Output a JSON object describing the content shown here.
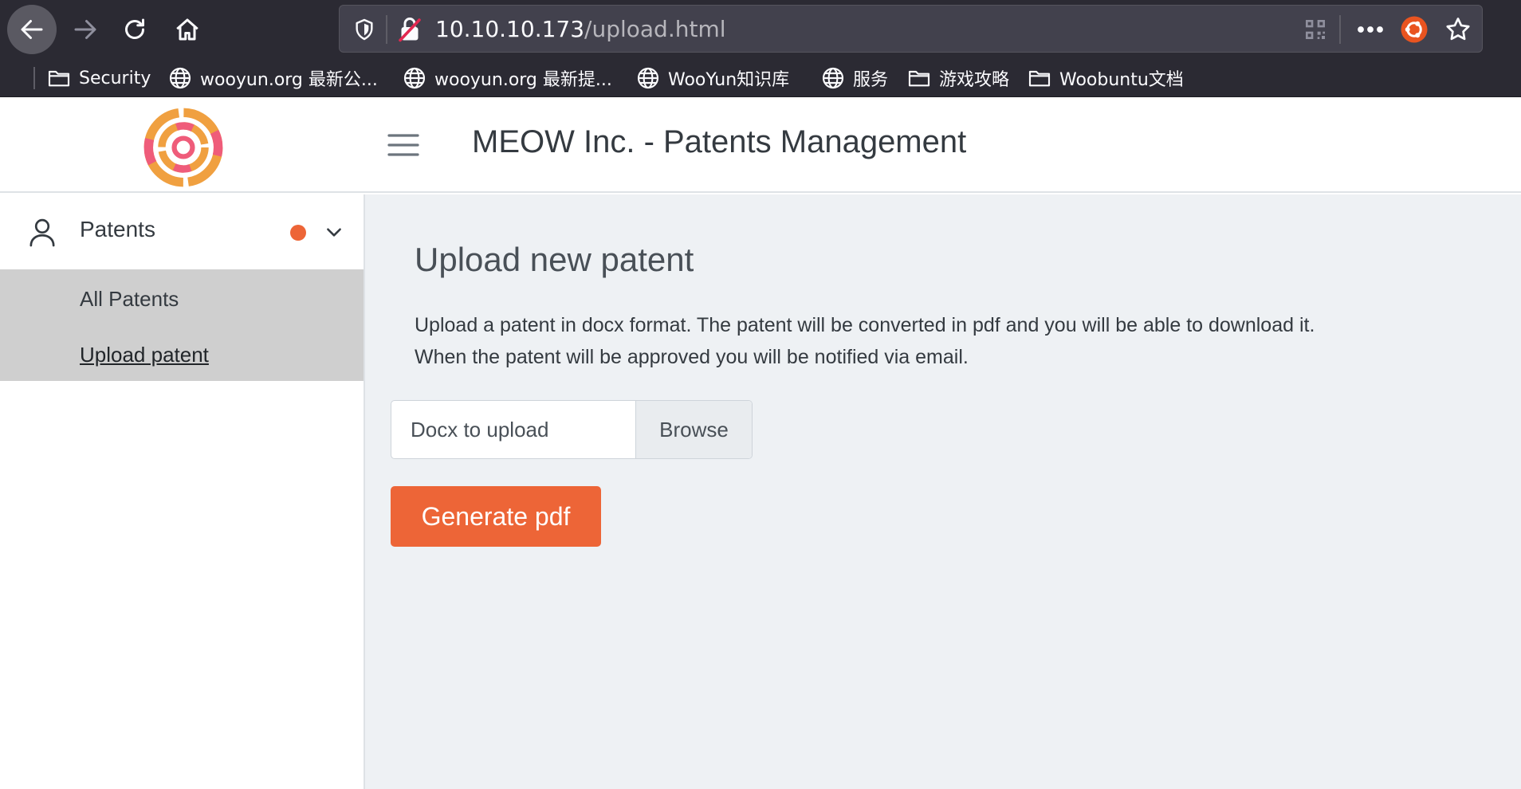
{
  "browser": {
    "url_host": "10.10.10.173",
    "url_path": "/upload.html",
    "bookmarks": [
      {
        "label": "Security",
        "icon": "folder-icon"
      },
      {
        "label": "wooyun.org 最新公...",
        "icon": "globe-icon"
      },
      {
        "label": "wooyun.org 最新提...",
        "icon": "globe-icon"
      },
      {
        "label": "WooYun知识库",
        "icon": "globe-icon"
      },
      {
        "label": "服务",
        "icon": "globe-icon"
      },
      {
        "label": "游戏攻略",
        "icon": "folder-icon"
      },
      {
        "label": "Woobuntu文档",
        "icon": "folder-icon"
      }
    ]
  },
  "header": {
    "title": "MEOW Inc. - Patents Management"
  },
  "sidebar": {
    "section_label": "Patents",
    "items": [
      {
        "label": "All Patents"
      },
      {
        "label": "Upload patent"
      }
    ]
  },
  "main": {
    "heading": "Upload new patent",
    "description_line1": "Upload a patent in docx format. The patent will be converted in pdf and you will be able to download it.",
    "description_line2": "When the patent will be approved you will be notified via email.",
    "file_input_placeholder": "Docx to upload",
    "browse_label": "Browse",
    "submit_label": "Generate pdf"
  },
  "colors": {
    "accent": "#ed6537",
    "main_bg": "#eef1f4",
    "submenu_bg": "#cfcfcf",
    "browser_chrome": "#2b2a33"
  }
}
